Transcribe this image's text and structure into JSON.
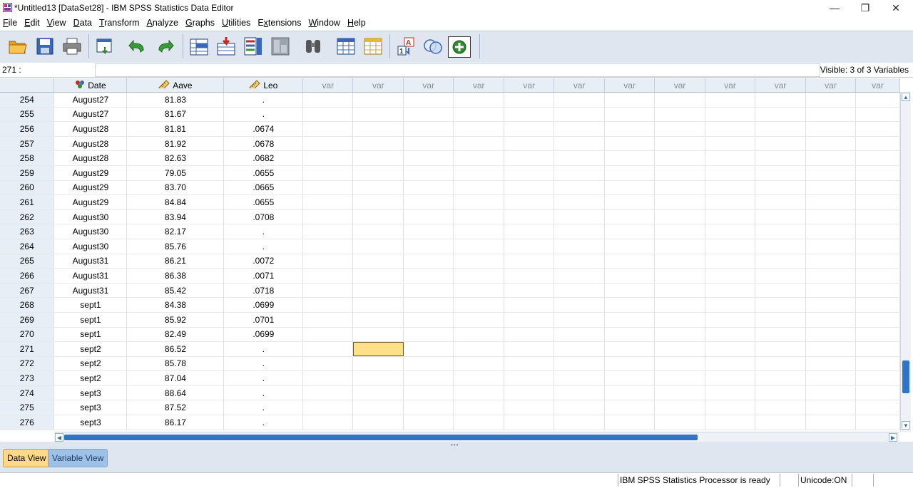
{
  "window": {
    "title": "*Untitled13 [DataSet28] - IBM SPSS Statistics Data Editor",
    "controls": {
      "minimize": "—",
      "restore": "❐",
      "close": "✕"
    }
  },
  "menu": [
    {
      "label": "File",
      "key": "F",
      "rest": "ile"
    },
    {
      "label": "Edit",
      "key": "E",
      "rest": "dit"
    },
    {
      "label": "View",
      "key": "V",
      "rest": "iew"
    },
    {
      "label": "Data",
      "key": "D",
      "rest": "ata"
    },
    {
      "label": "Transform",
      "key": "T",
      "rest": "ransform"
    },
    {
      "label": "Analyze",
      "key": "A",
      "rest": "nalyze"
    },
    {
      "label": "Graphs",
      "key": "G",
      "rest": "raphs"
    },
    {
      "label": "Utilities",
      "key": "U",
      "rest": "tilities"
    },
    {
      "label": "Extensions",
      "key": "x",
      "pre": "E",
      "rest": "tensions"
    },
    {
      "label": "Window",
      "key": "W",
      "rest": "indow"
    },
    {
      "label": "Help",
      "key": "H",
      "rest": "elp"
    }
  ],
  "toolbar_icons": [
    "open-data-icon",
    "save-icon",
    "print-icon",
    "recall-dialog-icon",
    "undo-icon",
    "redo-icon",
    "go-to-case-icon",
    "go-to-variable-icon",
    "variables-icon",
    "run-descriptives-icon",
    "find-icon",
    "insert-cases-icon",
    "insert-variable-icon",
    "split-file-icon",
    "weight-cases-icon",
    "select-cases-icon",
    "value-labels-icon",
    "use-variable-sets-icon"
  ],
  "cell_reference": {
    "name": "271 :",
    "value": ""
  },
  "visible_vars": "Visible: 3 of 3 Variables",
  "columns": [
    {
      "name": "Date",
      "type": "nominal-icon"
    },
    {
      "name": "Aave",
      "type": "scale-icon"
    },
    {
      "name": "Leo",
      "type": "scale-icon"
    }
  ],
  "empty_column_label": "var",
  "empty_column_count": 12,
  "rows": [
    {
      "n": "254",
      "date": "August27",
      "aave": "81.83",
      "leo": "."
    },
    {
      "n": "255",
      "date": "August27",
      "aave": "81.67",
      "leo": "."
    },
    {
      "n": "256",
      "date": "August28",
      "aave": "81.81",
      "leo": ".0674"
    },
    {
      "n": "257",
      "date": "August28",
      "aave": "81.92",
      "leo": ".0678"
    },
    {
      "n": "258",
      "date": "August28",
      "aave": "82.63",
      "leo": ".0682"
    },
    {
      "n": "259",
      "date": "August29",
      "aave": "79.05",
      "leo": ".0655"
    },
    {
      "n": "260",
      "date": "August29",
      "aave": "83.70",
      "leo": ".0665"
    },
    {
      "n": "261",
      "date": "August29",
      "aave": "84.84",
      "leo": ".0655"
    },
    {
      "n": "262",
      "date": "August30",
      "aave": "83.94",
      "leo": ".0708"
    },
    {
      "n": "263",
      "date": "August30",
      "aave": "82.17",
      "leo": "."
    },
    {
      "n": "264",
      "date": "August30",
      "aave": "85.76",
      "leo": "."
    },
    {
      "n": "265",
      "date": "August31",
      "aave": "86.21",
      "leo": ".0072"
    },
    {
      "n": "266",
      "date": "August31",
      "aave": "86.38",
      "leo": ".0071"
    },
    {
      "n": "267",
      "date": "August31",
      "aave": "85.42",
      "leo": ".0718"
    },
    {
      "n": "268",
      "date": "sept1",
      "aave": "84.38",
      "leo": ".0699"
    },
    {
      "n": "269",
      "date": "sept1",
      "aave": "85.92",
      "leo": ".0701"
    },
    {
      "n": "270",
      "date": "sept1",
      "aave": "82.49",
      "leo": ".0699"
    },
    {
      "n": "271",
      "date": "sept2",
      "aave": "86.52",
      "leo": "."
    },
    {
      "n": "272",
      "date": "sept2",
      "aave": "85.78",
      "leo": "."
    },
    {
      "n": "273",
      "date": "sept2",
      "aave": "87.04",
      "leo": "."
    },
    {
      "n": "274",
      "date": "sept3",
      "aave": "88.64",
      "leo": "."
    },
    {
      "n": "275",
      "date": "sept3",
      "aave": "87.52",
      "leo": "."
    },
    {
      "n": "276",
      "date": "sept3",
      "aave": "86.17",
      "leo": "."
    }
  ],
  "selected_cell": {
    "row": "271",
    "var_column": 2
  },
  "tabs": {
    "data_view": "Data View",
    "variable_view": "Variable View",
    "active": "Data View"
  },
  "status": {
    "processor": "IBM SPSS Statistics Processor is ready",
    "unicode": "Unicode:ON"
  },
  "colors": {
    "header_bg": "#e8eef6",
    "selected_cell": "#ffe08a",
    "active_tab": "#ffd98a",
    "inactive_tab": "#9ec1e8",
    "scroll_thumb": "#2e75c8"
  }
}
